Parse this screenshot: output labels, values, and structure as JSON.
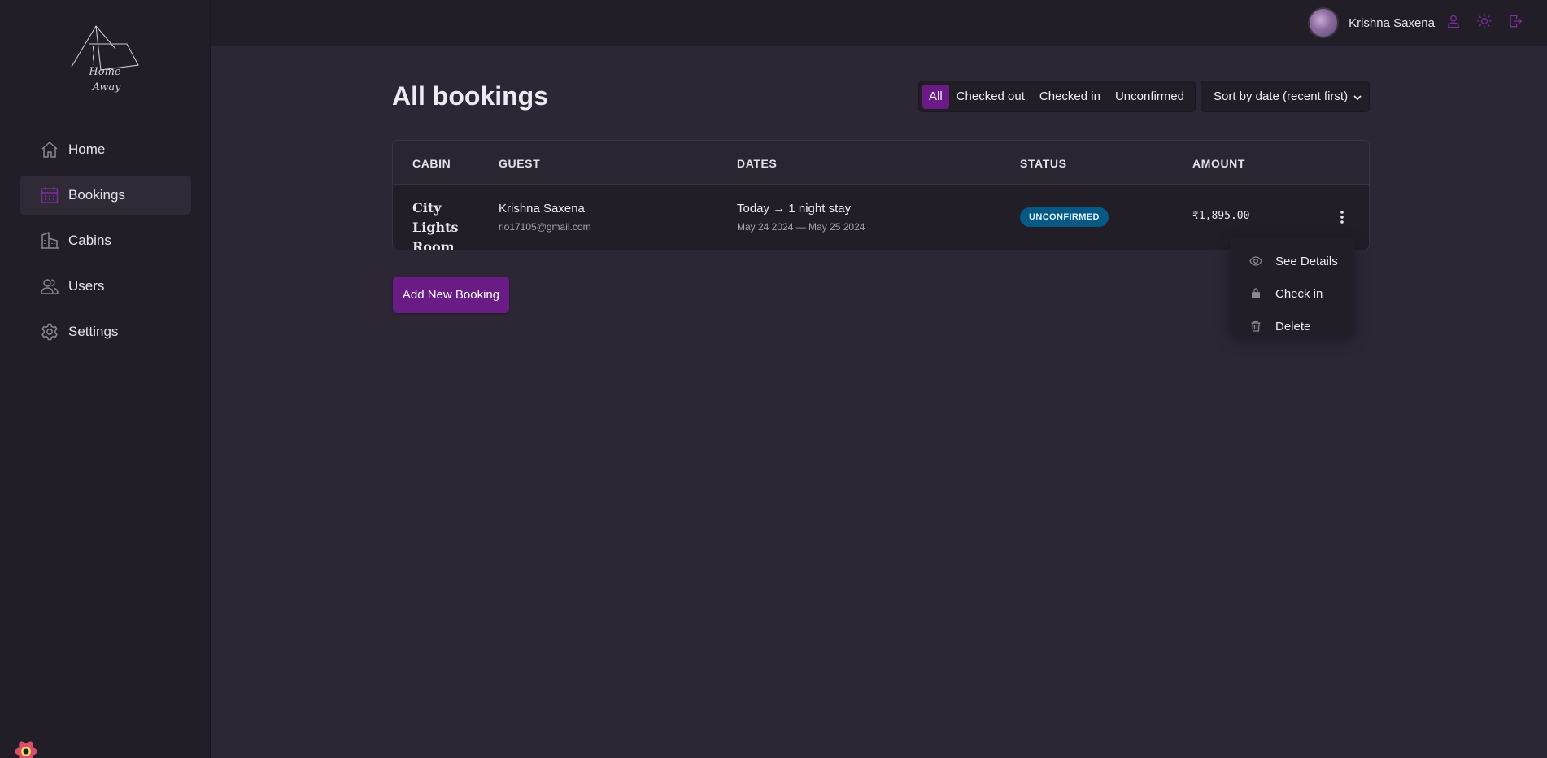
{
  "sidebar": {
    "logo_lines": [
      "Home",
      "Away"
    ],
    "items": [
      {
        "label": "Home",
        "icon": "home-icon"
      },
      {
        "label": "Bookings",
        "icon": "calendar-icon",
        "active": true
      },
      {
        "label": "Cabins",
        "icon": "buildings-icon"
      },
      {
        "label": "Users",
        "icon": "users-icon"
      },
      {
        "label": "Settings",
        "icon": "gear-icon"
      }
    ]
  },
  "header": {
    "username": "Krishna Saxena",
    "icons": [
      "user-icon",
      "sun-icon",
      "logout-icon"
    ]
  },
  "main": {
    "title": "All bookings",
    "filters": [
      "All",
      "Checked out",
      "Checked in",
      "Unconfirmed"
    ],
    "active_filter": "All",
    "sort_label": "Sort by date (recent first)",
    "table": {
      "headers": [
        "CABIN",
        "GUEST",
        "DATES",
        "STATUS",
        "AMOUNT"
      ],
      "rows": [
        {
          "cabin": "City Lights Room",
          "guest_name": "Krishna Saxena",
          "guest_email": "rio17105@gmail.com",
          "dates_main": "Today → 1 night stay",
          "dates_range": "May 24 2024 — May 25 2024",
          "status": "UNCONFIRMED",
          "amount": "₹1,895.00"
        }
      ]
    },
    "row_menu": [
      "See Details",
      "Check in",
      "Delete"
    ],
    "add_button": "Add New Booking"
  },
  "colors": {
    "accent": "#6a1b86",
    "status_unconfirmed_bg": "#075985",
    "sidebar_bg": "#221e27",
    "main_bg": "#2d2635"
  }
}
